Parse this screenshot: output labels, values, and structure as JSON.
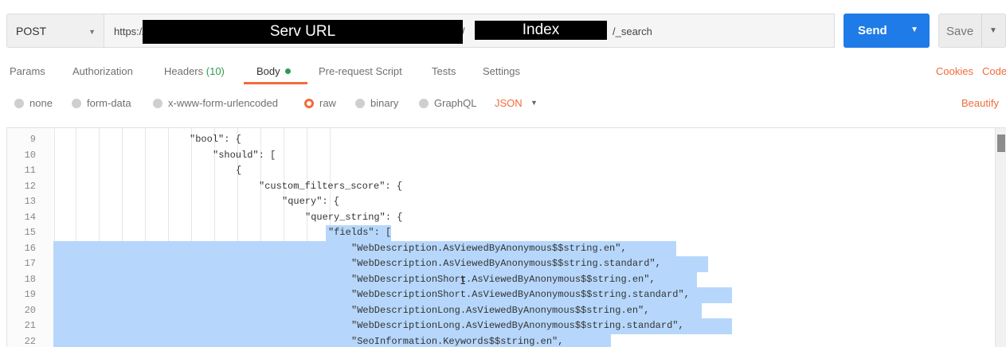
{
  "request": {
    "method": "POST",
    "url_protocol": "https://",
    "url_slash": "i/",
    "url_suffix": "/_search",
    "redacted_server_label": "Serv URL",
    "redacted_index_label": "Index",
    "send_label": "Send",
    "save_label": "Save"
  },
  "tabs": [
    {
      "label": "Params"
    },
    {
      "label": "Authorization"
    },
    {
      "label": "Headers",
      "count": "(10)"
    },
    {
      "label": "Body"
    },
    {
      "label": "Pre-request Script"
    },
    {
      "label": "Tests"
    },
    {
      "label": "Settings"
    }
  ],
  "right_links": {
    "cookies": "Cookies",
    "code": "Code"
  },
  "body_types": [
    {
      "label": "none"
    },
    {
      "label": "form-data"
    },
    {
      "label": "x-www-form-urlencoded"
    },
    {
      "label": "raw"
    },
    {
      "label": "binary"
    },
    {
      "label": "GraphQL"
    }
  ],
  "format_select": "JSON",
  "beautify_label": "Beautify",
  "editor": {
    "lines": [
      {
        "n": "9",
        "text": "\"bool\": {"
      },
      {
        "n": "10",
        "text": "\"should\": ["
      },
      {
        "n": "11",
        "text": "{"
      },
      {
        "n": "12",
        "text": "\"custom_filters_score\": {"
      },
      {
        "n": "13",
        "text": "\"query\": {"
      },
      {
        "n": "14",
        "text": "\"query_string\": {"
      },
      {
        "n": "15",
        "text": "\"fields\": ["
      },
      {
        "n": "16",
        "text": "\"WebDescription.AsViewedByAnonymous$$string.en\","
      },
      {
        "n": "17",
        "text": "\"WebDescription.AsViewedByAnonymous$$string.standard\","
      },
      {
        "n": "18",
        "text": "\"WebDescriptionShort.AsViewedByAnonymous$$string.en\","
      },
      {
        "n": "19",
        "text": "\"WebDescriptionShort.AsViewedByAnonymous$$string.standard\","
      },
      {
        "n": "20",
        "text": "\"WebDescriptionLong.AsViewedByAnonymous$$string.en\","
      },
      {
        "n": "21",
        "text": "\"WebDescriptionLong.AsViewedByAnonymous$$string.standard\","
      },
      {
        "n": "22",
        "text": "\"SeoInformation.Keywords$$string.en\","
      }
    ]
  },
  "colors": {
    "accent": "#f26b3a",
    "send_button": "#1f7be8",
    "selection": "#b6d7fb",
    "status_green": "#2d9b50"
  }
}
